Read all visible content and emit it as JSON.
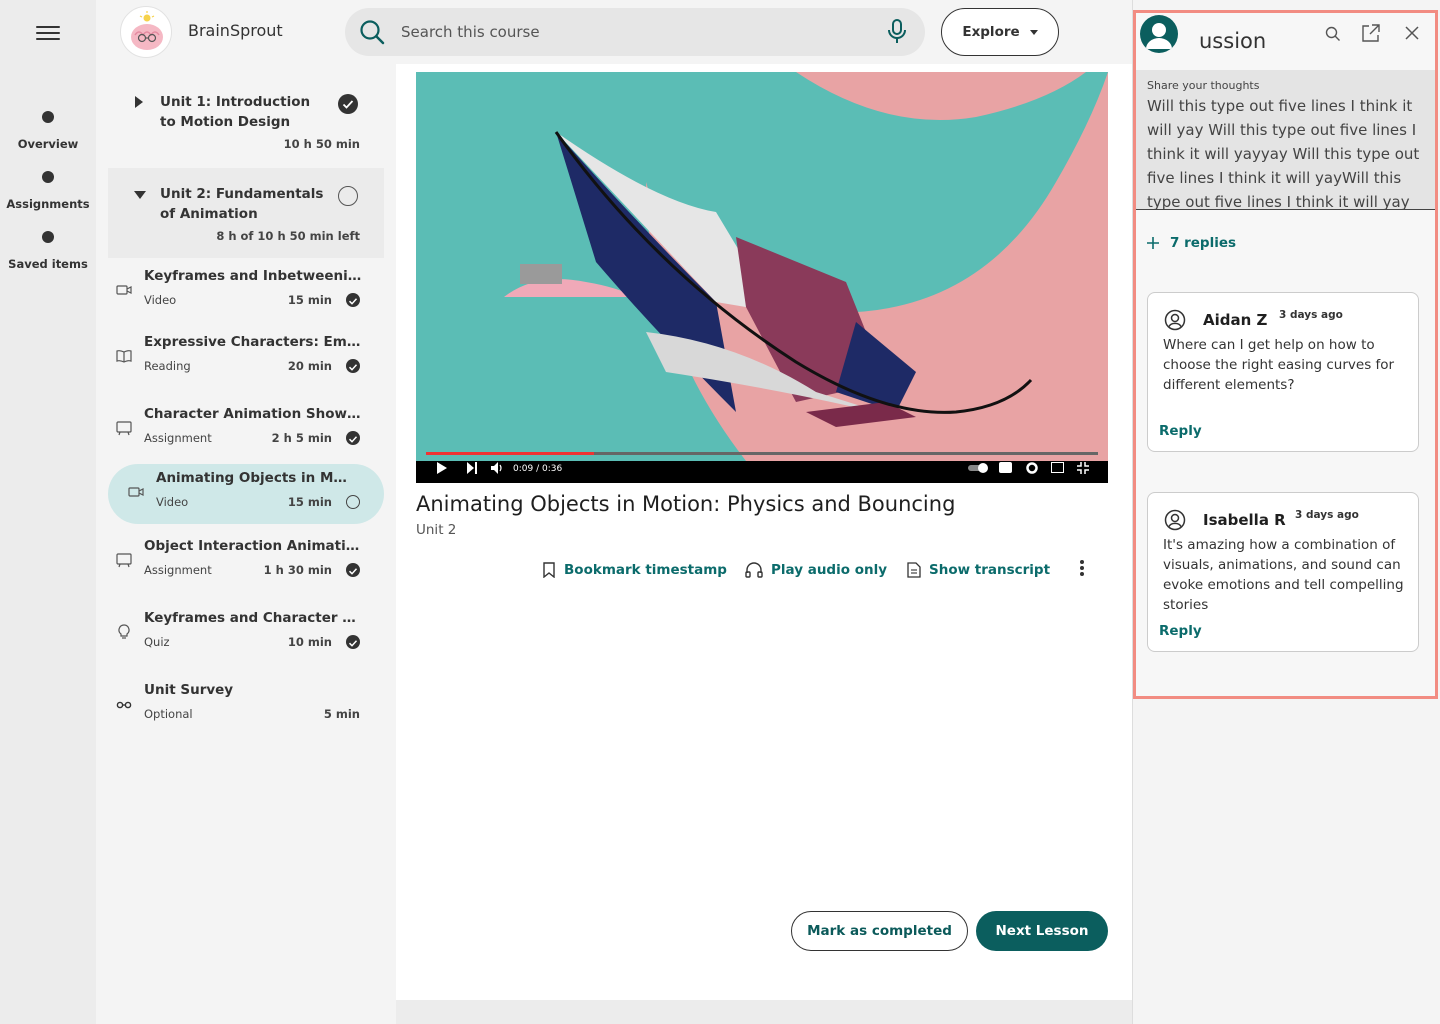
{
  "rail": {
    "items": [
      {
        "label": "Overview"
      },
      {
        "label": "Assignments"
      },
      {
        "label": "Saved items"
      }
    ]
  },
  "header": {
    "brand": "BrainSprout",
    "search_placeholder": "Search this course",
    "explore_label": "Explore"
  },
  "course": {
    "units": [
      {
        "title": "Unit 1: Introduction to Motion Design",
        "meta": "10 h 50 min",
        "status": "completed"
      },
      {
        "title": "Unit 2: Fundamentals of Animation",
        "meta": "8 h of 10 h 50 min left",
        "status": "in-progress"
      }
    ],
    "lessons": [
      {
        "title": "Keyframes and Inbetweening",
        "type": "Video",
        "duration": "15 min",
        "status": "completed",
        "icon": "video-icon"
      },
      {
        "title": "Expressive Characters: Emoti…",
        "type": "Reading",
        "duration": "20 min",
        "status": "completed",
        "icon": "book-icon"
      },
      {
        "title": "Character Animation Showcase",
        "type": "Assignment",
        "duration": "2 h 5 min",
        "status": "completed",
        "icon": "assignment-icon"
      },
      {
        "title": "Animating Objects in Motio…",
        "type": "Video",
        "duration": "15 min",
        "status": "not-started",
        "icon": "video-icon"
      },
      {
        "title": "Object Interaction Animation",
        "type": "Assignment",
        "duration": "1 h 30 min",
        "status": "completed",
        "icon": "assignment-icon"
      },
      {
        "title": "Keyframes and Character Ani…",
        "type": "Quiz",
        "duration": "10 min",
        "status": "completed",
        "icon": "lightbulb-icon"
      },
      {
        "title": "Unit Survey",
        "type": "Optional",
        "duration": "5 min",
        "status": "none",
        "icon": "glasses-icon"
      }
    ]
  },
  "main": {
    "video": {
      "time": "0:09 / 0:36",
      "progress_fraction": 0.25
    },
    "title": "Animating Objects in Motion: Physics and Bouncing",
    "unit": "Unit 2",
    "actions": {
      "bookmark": "Bookmark timestamp",
      "audio": "Play audio only",
      "transcript": "Show transcript"
    },
    "mark_completed": "Mark as completed",
    "next_lesson": "Next Lesson"
  },
  "discussion": {
    "title": "ussion",
    "thoughts_label": "Share your thoughts",
    "thoughts_text": "Will this type out five lines I think it will yay Will this type out five lines I think it will yayyay Will this type out five lines I think it will yayWill this type out five lines I think it will yay",
    "replies_label": "7 replies",
    "comments": [
      {
        "author": "Aidan Z",
        "time": "3 days ago",
        "body": "Where can I get help on how to choose the right easing curves for different elements?",
        "reply_label": "Reply"
      },
      {
        "author": "Isabella R",
        "time": "3 days ago",
        "body": "It's amazing how a combination of visuals, animations, and sound can evoke emotions and tell compelling stories",
        "reply_label": "Reply"
      }
    ]
  },
  "colors": {
    "accent": "#0b5e5e",
    "link": "#0b6b6b",
    "active_lesson": "#cfe8e8",
    "highlight_border": "#f28c82",
    "video_teal": "#5bbdb5",
    "video_pink": "#e8a3a4"
  }
}
